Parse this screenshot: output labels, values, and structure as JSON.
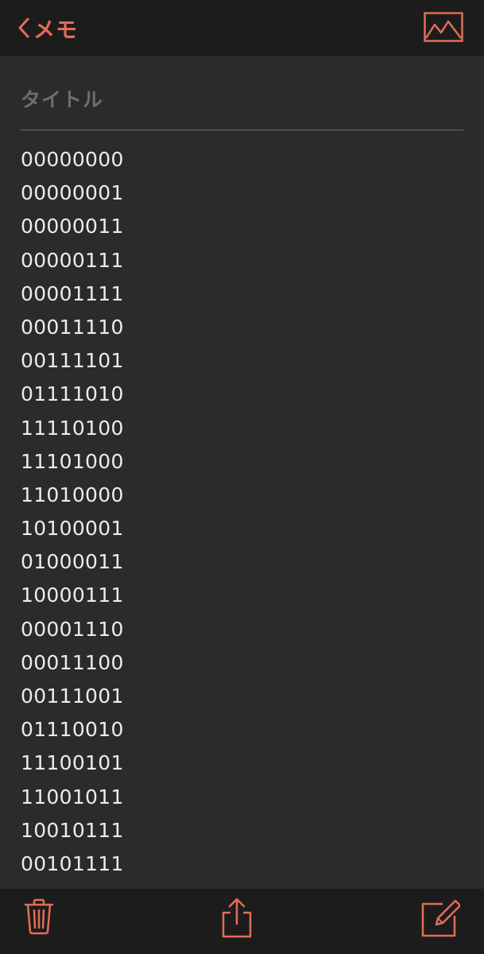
{
  "nav": {
    "back_label": "メモ",
    "image_icon": "image-icon",
    "accent_color": "#e26d58"
  },
  "note": {
    "title_placeholder": "タイトル",
    "lines": [
      "00000000",
      "00000001",
      "00000011",
      "00000111",
      "00001111",
      "00011110",
      "00111101",
      "01111010",
      "11110100",
      "11101000",
      "11010000",
      "10100001",
      "01000011",
      "10000111",
      "00001110",
      "00011100",
      "00111001",
      "01110010",
      "11100101",
      "11001011",
      "10010111",
      "00101111"
    ]
  },
  "toolbar": {
    "icons": [
      "trash-icon",
      "share-icon",
      "compose-icon"
    ]
  },
  "colors": {
    "background": "#2b2b2b",
    "bars": "#1c1c1c",
    "text": "#ececec",
    "placeholder": "#6e6e6e"
  }
}
